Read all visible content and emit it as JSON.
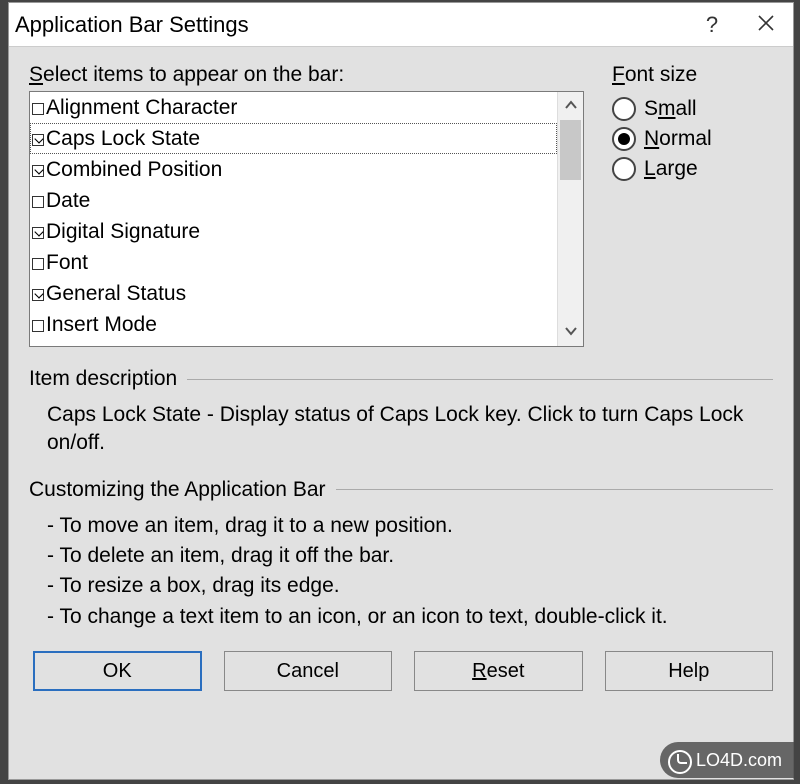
{
  "titlebar": {
    "title": "Application Bar Settings"
  },
  "select_label_pre": "S",
  "select_label_rest": "elect items to appear on the bar:",
  "items": [
    {
      "label": "Alignment Character",
      "checked": false,
      "selected": false
    },
    {
      "label": "Caps Lock State",
      "checked": true,
      "selected": true
    },
    {
      "label": "Combined Position",
      "checked": true,
      "selected": false
    },
    {
      "label": "Date",
      "checked": false,
      "selected": false
    },
    {
      "label": "Digital Signature",
      "checked": true,
      "selected": false
    },
    {
      "label": "Font",
      "checked": false,
      "selected": false
    },
    {
      "label": "General Status",
      "checked": true,
      "selected": false
    },
    {
      "label": "Insert Mode",
      "checked": false,
      "selected": false
    }
  ],
  "font": {
    "label_pre": "F",
    "label_rest": "ont size",
    "options": [
      {
        "value": "small",
        "pre": "S",
        "u": "m",
        "post": "all",
        "checked": false
      },
      {
        "value": "normal",
        "pre": "",
        "u": "N",
        "post": "ormal",
        "checked": true
      },
      {
        "value": "large",
        "pre": "",
        "u": "L",
        "post": "arge",
        "checked": false
      }
    ]
  },
  "description": {
    "header": "Item description",
    "text": "Caps Lock State - Display status of Caps Lock key.  Click to turn Caps Lock on/off."
  },
  "customize": {
    "header": "Customizing the Application Bar",
    "bullets": [
      "- To move an item, drag it to a new position.",
      "- To delete an item, drag it off the bar.",
      "- To resize a box, drag its edge.",
      "- To change a text item to an icon, or an icon to text, double-click it."
    ]
  },
  "buttons": {
    "ok": "OK",
    "cancel": "Cancel",
    "reset_pre": "",
    "reset_u": "R",
    "reset_post": "eset",
    "help_post": "elp"
  },
  "watermark": "LO4D.com"
}
